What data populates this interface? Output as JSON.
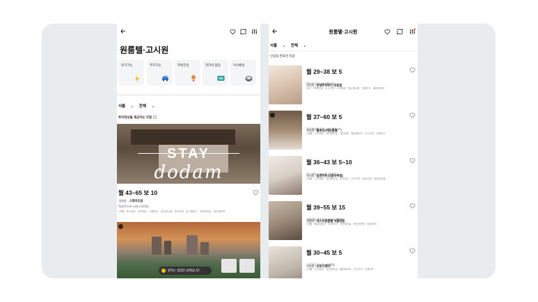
{
  "left": {
    "title": "원룸텔·고시원",
    "categories": [
      {
        "label": "반기가능",
        "icon": "lightning-icon"
      },
      {
        "label": "주차가능",
        "icon": "car-icon"
      },
      {
        "label": "여성전용",
        "icon": "female-icon"
      },
      {
        "label": "관리비 없음",
        "icon": "tv-icon"
      },
      {
        "label": "이사배송",
        "icon": "box-icon"
      }
    ],
    "filter": {
      "region": "서울",
      "scope": "전체"
    },
    "notice": "투어영상을 제공하는 지점",
    "hero": {
      "overlay_top": "STAY",
      "overlay_bottom": "dodam"
    },
    "listing": {
      "price": "월 43~65 보 10",
      "type_tag": "원룸텔",
      "name": "스테이도담",
      "location": "역삼역 도보 10분 (가산동)",
      "tags": "1개월 · 포르공조 · 와이파이 · 신용카드 · 현금영수증 · 청소업체 · 공기청정기 · 개인화장실 · 개인세면대"
    },
    "toast": "원하는 설정된 상태입니다."
  },
  "right": {
    "header_title": "원룸텔·고시원",
    "filter": {
      "region": "서울",
      "scope": "전체"
    },
    "notice": "인증을 완료한 지점",
    "items": [
      {
        "price": "월 29~38  보 5",
        "type": "고시원",
        "name": "온새미하우스 강동점",
        "location": "천호역 도보 2분 (천호동)",
        "tags": "3개~ · 여성전용 · 주식가전 · 식사제공 · 현금영수증 · 신용카드 · 엘리베이터"
      },
      {
        "price": "월 37~60  보 5",
        "type": "고시원",
        "name": "블레오4개윈룸텔",
        "badge": "1",
        "location": "잠실새내역 도보 3분 (잠실4가)",
        "tags": "1개월 · 식사제공 · 개인화장실 · 개인창문 · 엘리베이터 · 주식가전 · 신용카드"
      },
      {
        "price": "월 36~43  보 5~10",
        "type": "고시원",
        "name": "심경하우스(광나루점)",
        "location": "광나루역 도보 2분 (광진동)",
        "tags": "1개월 · 식사제공 · 개인화장실 · 주차공간 · 주식가전 · 청소업체 · 현금영수증"
      },
      {
        "price": "월 39~55  보 15",
        "type": "원룸텔",
        "name": "게스트원룸텔 서울대점",
        "location": "서울대입구역 도보 10분 (봉천동)",
        "tags": "1개월 · 엘리베이터 · 와이파이 · 개인화장실 · 개인세면대 · 청소업체"
      },
      {
        "price": "월 30~45  보 5",
        "type": "고시원",
        "name": "소호스테이",
        "location": "노원역 도보 3분 (상계동)",
        "tags": "1개월 · 식사제공 · 개인화장실 · 엘리베이터 · 주식가전 · 신용카드"
      }
    ]
  },
  "colors": {
    "frame_bg": "#e9ecee",
    "accent_red": "#ff3b30",
    "toast_bg": "#333333"
  }
}
